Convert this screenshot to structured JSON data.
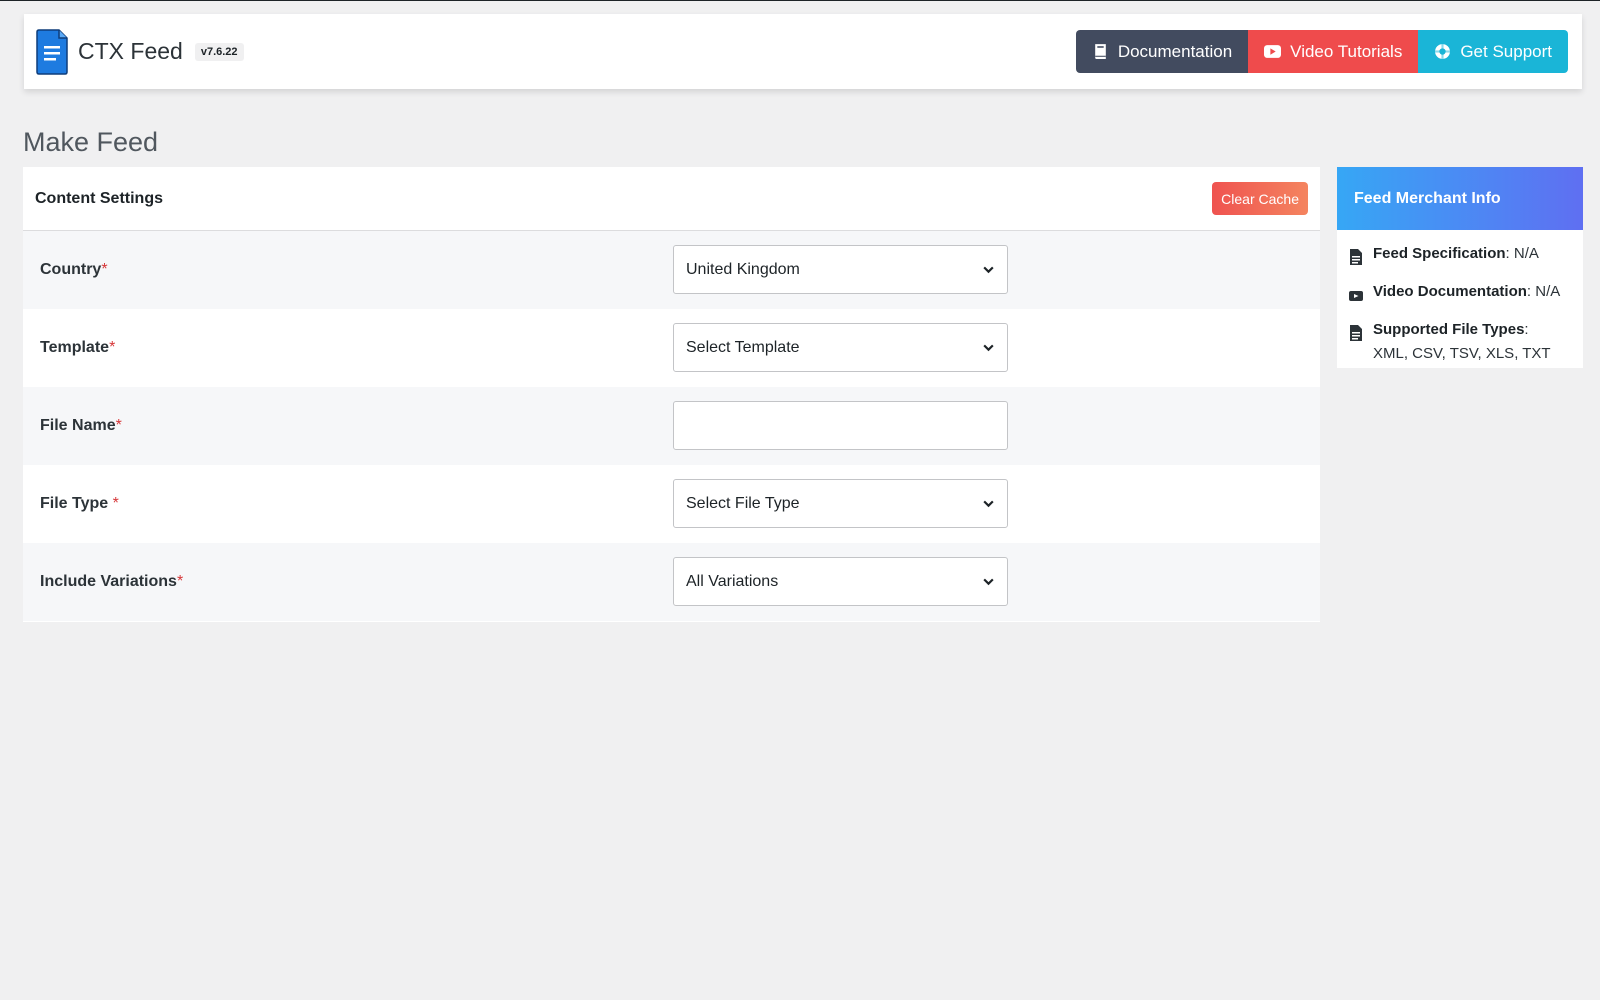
{
  "header": {
    "brand_title": "CTX Feed",
    "version": "v7.6.22",
    "buttons": {
      "documentation": "Documentation",
      "video_tutorials": "Video Tutorials",
      "get_support": "Get Support"
    }
  },
  "page_title": "Make Feed",
  "content_settings": {
    "title": "Content Settings",
    "clear_cache": "Clear Cache",
    "rows": [
      {
        "label": "Country",
        "required": "*",
        "value": "United Kingdom",
        "type": "select"
      },
      {
        "label": "Template",
        "required": "*",
        "value": "Select Template",
        "type": "select"
      },
      {
        "label": "File Name",
        "required": "*",
        "value": "",
        "type": "input"
      },
      {
        "label": "File Type ",
        "required": "*",
        "value": "Select File Type",
        "type": "select"
      },
      {
        "label": "Include Variations",
        "required": "*",
        "value": "All Variations",
        "type": "select"
      }
    ]
  },
  "merchant_info": {
    "title": "Feed Merchant Info",
    "items": [
      {
        "label": "Feed Specification",
        "value": ": N/A",
        "icon": "document-icon"
      },
      {
        "label": "Video Documentation",
        "value": ": N/A",
        "icon": "video-icon"
      },
      {
        "label": "Supported File Types",
        "value": ":",
        "extra": "XML, CSV, TSV, XLS, TXT",
        "icon": "document-icon"
      }
    ]
  },
  "colors": {
    "docs_button": "#424b5f",
    "video_button": "#ef4b4c",
    "support_button": "#1ab5d7",
    "required": "#d63638"
  }
}
